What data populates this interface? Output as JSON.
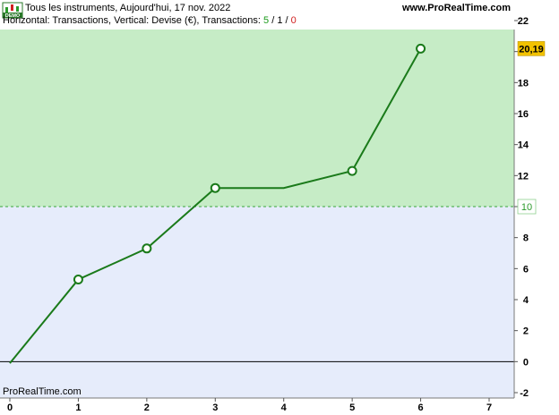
{
  "header": {
    "title": "Tous les instruments, Aujourd'hui, 17 nov. 2022",
    "site": "www.ProRealTime.com",
    "logo_text": "DEMO"
  },
  "subtitle": {
    "prefix": "Horizontal: Transactions, Vertical: Devise (€), Transactions: ",
    "wins": "5",
    "sep1": " / ",
    "neutral": "1",
    "sep2": " / ",
    "losses": "0"
  },
  "watermark": "ProRealTime.com",
  "colors": {
    "line": "#1a7a1a",
    "profit_zone": "#c6ecc6",
    "loss_zone": "#e6ecfb",
    "last_value_badge": "#f2c200",
    "reference_label": "#2a9a2a"
  },
  "chart_data": {
    "type": "line",
    "x": [
      0,
      1,
      2,
      3,
      4,
      5,
      6
    ],
    "y": [
      -0.1,
      5.3,
      7.3,
      11.2,
      11.2,
      12.3,
      20.19
    ],
    "trade_markers_x": [
      1,
      2,
      3,
      5,
      6
    ],
    "xticks": [
      "0",
      "1",
      "2",
      "3",
      "4",
      "5",
      "6",
      "7"
    ],
    "yticks": [
      "-2",
      "0",
      "2",
      "4",
      "6",
      "8",
      "10",
      "12",
      "14",
      "16",
      "18",
      "20",
      "22"
    ],
    "xlim": [
      0,
      7
    ],
    "ylim": [
      -2,
      22
    ],
    "reference_level": 10,
    "reference_label": "10",
    "last_value": 20.19,
    "last_value_label": "20,19",
    "grid": false
  }
}
